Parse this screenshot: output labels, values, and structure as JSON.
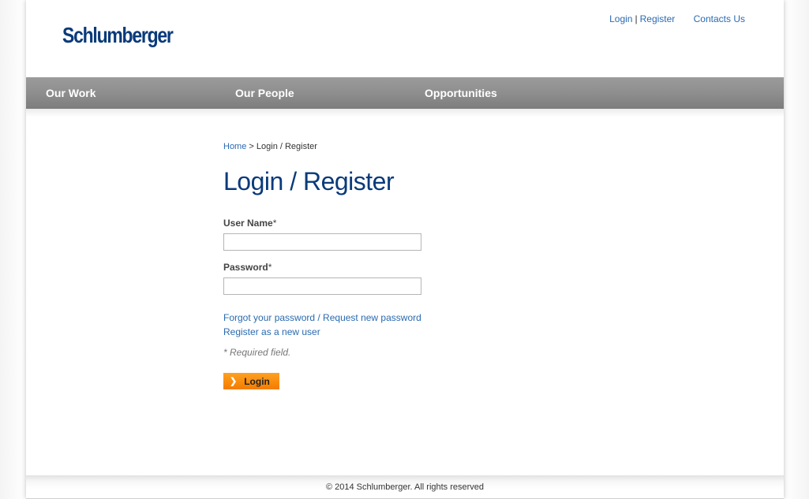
{
  "header": {
    "logo_text": "Schlumberger",
    "links": {
      "login": "Login",
      "separator": "|",
      "register": "Register",
      "contacts": "Contacts Us"
    }
  },
  "nav": {
    "items": [
      {
        "label": "Our Work"
      },
      {
        "label": "Our People"
      },
      {
        "label": "Opportunities"
      }
    ]
  },
  "breadcrumb": {
    "home": "Home",
    "separator": ">",
    "current": "Login / Register"
  },
  "page_title": "Login / Register",
  "form": {
    "username_label": "User Name",
    "password_label": "Password",
    "required_mark": "*",
    "username_value": "",
    "password_value": "",
    "forgot_link": "Forgot your password / Request new password",
    "register_link": "Register as a new user",
    "required_note": "* Required field.",
    "submit_label": "Login",
    "submit_icon": "chevron-right-icon"
  },
  "footer": {
    "copyright": "© 2014 Schlumberger. All rights reserved"
  },
  "colors": {
    "brand": "#0a3a7a",
    "link": "#2a6ab0",
    "nav_bg": "#8e8e8e",
    "button": "#f47c00"
  }
}
